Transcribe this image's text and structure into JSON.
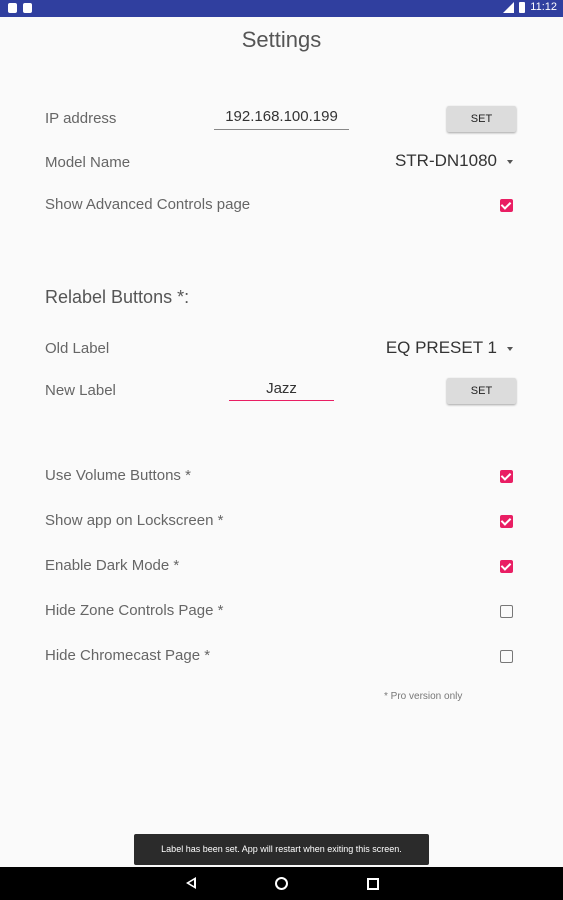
{
  "status_bar": {
    "time": "11:12"
  },
  "page": {
    "title": "Settings"
  },
  "ip": {
    "label": "IP address",
    "value": "192.168.100.199",
    "set_label": "SET"
  },
  "model": {
    "label": "Model Name",
    "value": "STR-DN1080"
  },
  "advanced": {
    "label": "Show Advanced Controls page",
    "checked": true
  },
  "relabel": {
    "section_title": "Relabel Buttons *:",
    "old_label": "Old Label",
    "old_value": "EQ PRESET 1",
    "new_label": "New Label",
    "new_value": "Jazz",
    "set_label": "SET"
  },
  "options": {
    "volume": {
      "label": "Use Volume Buttons *",
      "checked": true
    },
    "lockscreen": {
      "label": "Show app on Lockscreen *",
      "checked": true
    },
    "dark": {
      "label": "Enable Dark Mode *",
      "checked": true
    },
    "zone": {
      "label": "Hide Zone Controls Page *",
      "checked": false
    },
    "chromecast": {
      "label": "Hide Chromecast Page *",
      "checked": false
    }
  },
  "footnote": "* Pro version only",
  "toast": "Label has been set. App will restart when exiting this screen.",
  "colors": {
    "accent": "#e91e63",
    "status_bar": "#303f9f"
  },
  "icons": {
    "back": "back-icon",
    "home": "home-icon",
    "recent": "recent-apps-icon"
  }
}
